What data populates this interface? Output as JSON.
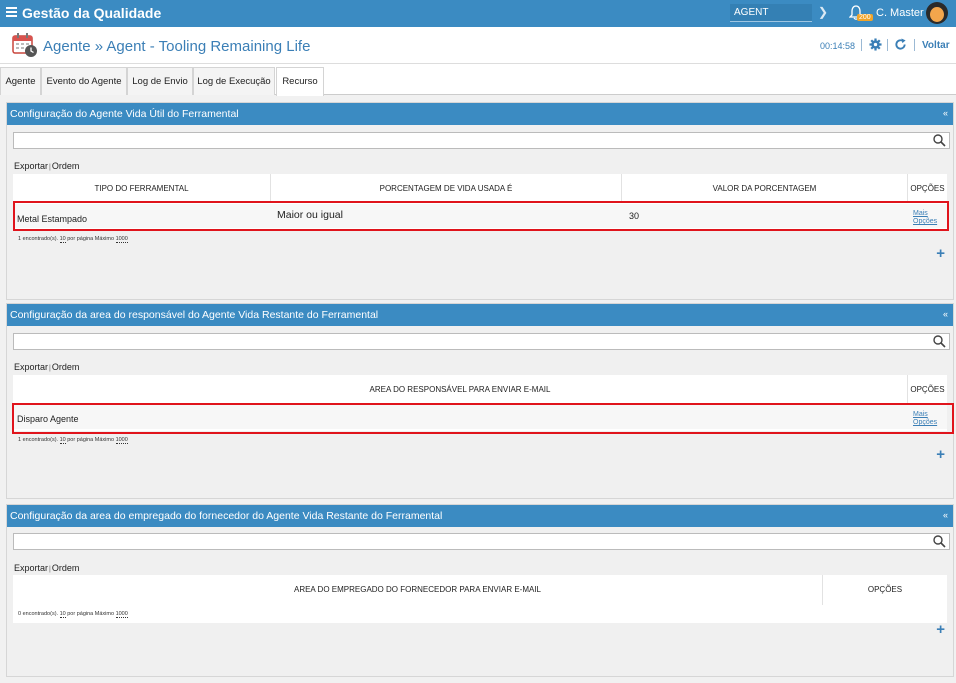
{
  "topbar": {
    "app_title": "Gestão da Qualidade",
    "agent_value": "AGENT",
    "notification_count": "200",
    "user_name": "C. Master"
  },
  "header": {
    "title": "Agente » Agent - Tooling Remaining Life",
    "timer": "00:14:58",
    "back_label": "Voltar"
  },
  "tabs": [
    {
      "label": "Agente"
    },
    {
      "label": "Evento do Agente"
    },
    {
      "label": "Log de Envio"
    },
    {
      "label": "Log de Execução"
    },
    {
      "label": "Recurso",
      "active": true
    }
  ],
  "panels": [
    {
      "title": "Configuração do Agente Vida Útil do Ferramental",
      "export_label": "Exportar",
      "order_label": "Ordem",
      "columns": [
        "TIPO DO FERRAMENTAL",
        "PORCENTAGEM DE VIDA USADA É",
        "VALOR DA PORCENTAGEM",
        "OPÇÕES"
      ],
      "rows": [
        {
          "tipo": "Metal Estampado",
          "porcentagem": "Maior ou igual",
          "valor": "30",
          "opcoes_1": "Mais",
          "opcoes_2": "Opções"
        }
      ],
      "footer": {
        "found": "1 encontrado(s).",
        "per_page": "10",
        "per_page_label": "por página Máximo",
        "max": "1000"
      }
    },
    {
      "title": "Configuração da area do responsável do Agente Vida Restante do Ferramental",
      "export_label": "Exportar",
      "order_label": "Ordem",
      "columns": [
        "AREA DO RESPONSÁVEL PARA ENVIAR E-MAIL",
        "OPÇÕES"
      ],
      "rows": [
        {
          "area": "Disparo Agente",
          "opcoes_1": "Mais",
          "opcoes_2": "Opções"
        }
      ],
      "footer": {
        "found": "1 encontrado(s).",
        "per_page": "10",
        "per_page_label": "por página Máximo",
        "max": "1000"
      }
    },
    {
      "title": "Configuração da area do empregado do fornecedor do Agente Vida Restante do Ferramental",
      "export_label": "Exportar",
      "order_label": "Ordem",
      "columns": [
        "AREA DO EMPREGADO DO FORNECEDOR PARA ENVIAR E-MAIL",
        "OPÇÕES"
      ],
      "rows": [],
      "footer": {
        "found": "0 encontrado(s).",
        "per_page": "10",
        "per_page_label": "por página Máximo",
        "max": "1000"
      }
    }
  ],
  "collapse_symbol": "«",
  "add_symbol": "+",
  "colors": {
    "primary": "#3b8bc2",
    "link": "#3b7fb6",
    "highlight": "#e0141c",
    "badge": "#f0a42a"
  },
  "icons": [
    "menu-icon",
    "chevron-right-icon",
    "bell-icon",
    "calendar-icon",
    "gear-icon",
    "refresh-icon",
    "search-icon",
    "plus-icon",
    "collapse-icon"
  ]
}
